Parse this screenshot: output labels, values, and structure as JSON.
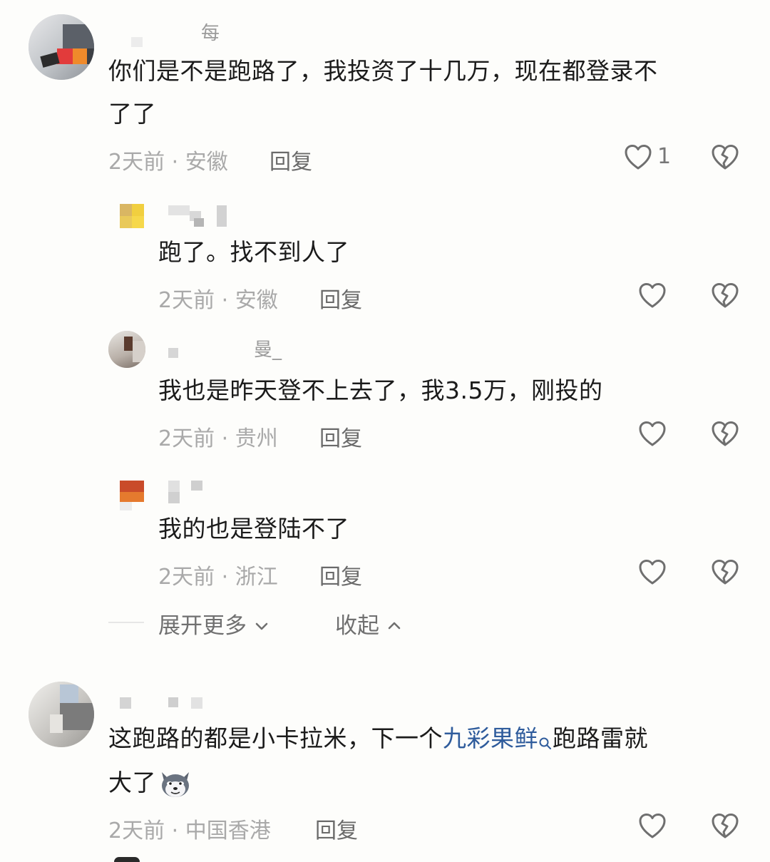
{
  "comments": [
    {
      "username": "每",
      "text": "你们是不是跑路了，我投资了十几万，现在都登录不了了",
      "line1": "你们是不是跑路了，我投资了十几万，现在都登录不",
      "line2": "了了",
      "time": "2天前",
      "location": "安徽",
      "reply": "回复",
      "likes": "1",
      "replies": [
        {
          "username": "",
          "text": "跑了。找不到人了",
          "time": "2天前",
          "location": "安徽",
          "reply": "回复"
        },
        {
          "username": "曼_",
          "text": "我也是昨天登不上去了，我3.5万，刚投的",
          "time": "2天前",
          "location": "贵州",
          "reply": "回复"
        },
        {
          "username": "",
          "text": "我的也是登陆不了",
          "time": "2天前",
          "location": "浙江",
          "reply": "回复"
        }
      ],
      "expand_more": "展开更多",
      "collapse": "收起"
    },
    {
      "username": "",
      "text_before": "这跑路的都是小卡拉米，下一个",
      "link_text": "九彩果鲜",
      "text_after": "跑路雷就",
      "line2": "大了",
      "time": "2天前",
      "location": "中国香港",
      "reply": "回复"
    }
  ],
  "meta_separator": "·",
  "icons": {
    "like": "heart-outline-icon",
    "dislike": "broken-heart-icon",
    "search": "search-icon",
    "emoji": "husky-emoji-icon"
  },
  "colors": {
    "link": "#2f5c9c",
    "meta": "#a9a9a9",
    "text": "#1b1b1b"
  }
}
